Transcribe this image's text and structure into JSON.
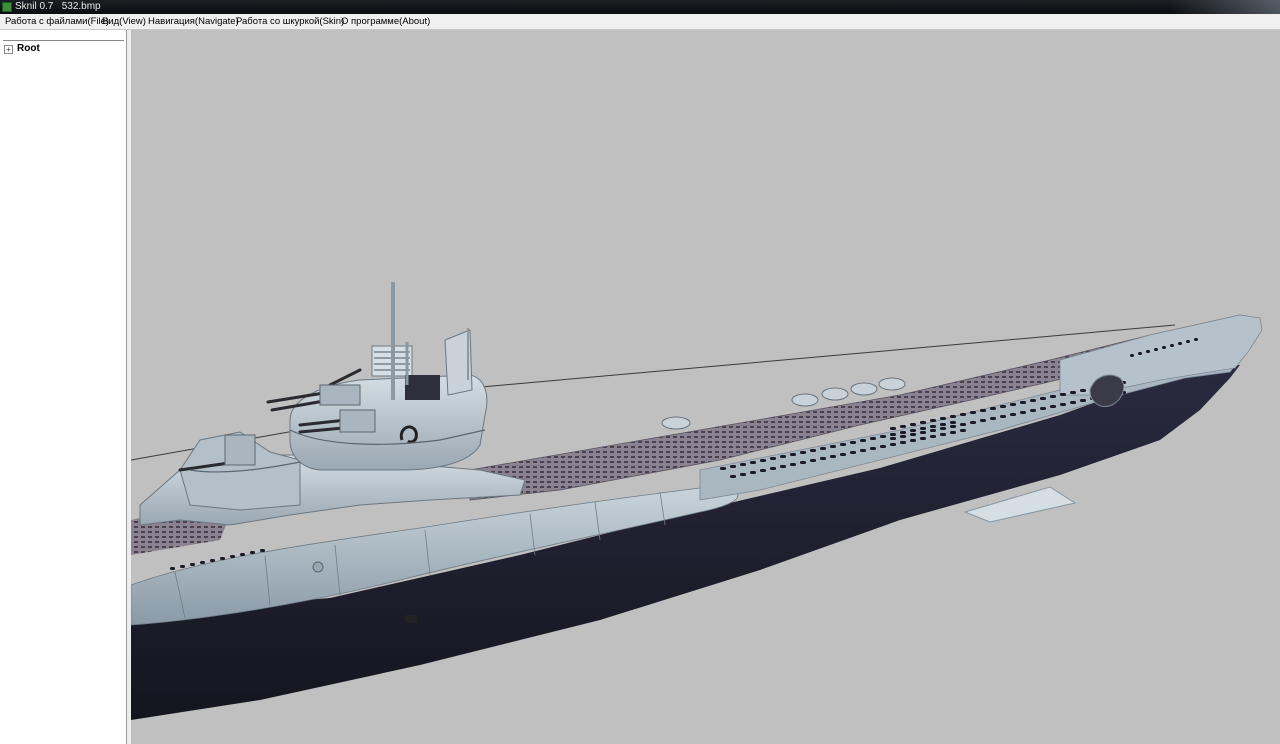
{
  "window": {
    "title": "Sknil 0.7   532.bmp"
  },
  "menu": [
    {
      "label": "Работа с файлами(File)"
    },
    {
      "label": "Вид(View)"
    },
    {
      "label": "Навигация(Navigate)"
    },
    {
      "label": "Работа со шкуркой(Skin)"
    },
    {
      "label": "О программе(About)"
    }
  ],
  "tree": {
    "root_label": "Root",
    "expander": "+"
  },
  "viewport": {
    "background": "#c0c0c0",
    "model": "submarine-3d-model"
  }
}
